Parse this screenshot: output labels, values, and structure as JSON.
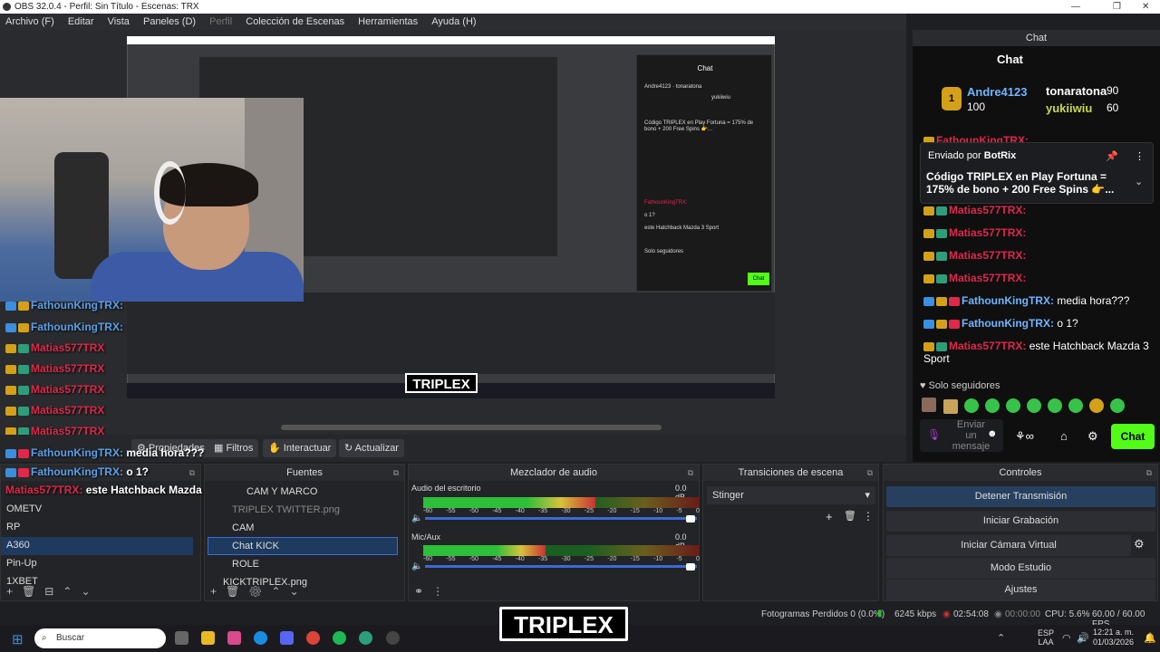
{
  "window": {
    "title": "OBS 32.0.4 - Perfil: Sin Título - Escenas: TRX"
  },
  "menu": [
    "Archivo (F)",
    "Editar",
    "Vista",
    "Paneles (D)",
    "Perfil",
    "Colección de Escenas",
    "Herramientas",
    "Ayuda (H)"
  ],
  "toolbar": {
    "properties": "Propiedades",
    "filters": "Filtros",
    "interact": "Interactuar",
    "refresh": "Actualizar"
  },
  "scenes": {
    "items": [
      "OMETV",
      "RP",
      "A360",
      "Pin-Up",
      "1XBET"
    ],
    "selected": "A360"
  },
  "sources": {
    "title": "Fuentes",
    "items": [
      {
        "label": "CAM Y MARCO"
      },
      {
        "label": "TRIPLEX TWITTER.png"
      },
      {
        "label": "CAM"
      },
      {
        "label": "Chat KICK"
      },
      {
        "label": "ROLE"
      },
      {
        "label": "KICKTRIPLEX.png"
      }
    ]
  },
  "mixer": {
    "title": "Mezclador de audio",
    "channels": [
      {
        "name": "Audio del escritorio",
        "db": "0.0 dB",
        "level": 0.62,
        "volume": 1.0
      },
      {
        "name": "Mic/Aux",
        "db": "0.0 dB",
        "level": 0.45,
        "volume": 1.0
      }
    ],
    "scale": [
      "-60",
      "-55",
      "-50",
      "-45",
      "-40",
      "-35",
      "-30",
      "-25",
      "-20",
      "-15",
      "-10",
      "-5",
      "0"
    ]
  },
  "transitions": {
    "title": "Transiciones de escena",
    "current": "Stinger"
  },
  "controls": {
    "title": "Controles",
    "buttons": [
      "Detener Transmisión",
      "Iniciar Grabación",
      "Iniciar Cámara Virtual",
      "Modo Estudio",
      "Ajustes"
    ]
  },
  "chat": {
    "title": "Chat",
    "header": "Chat",
    "top": [
      {
        "rank": "1",
        "name": "Andre4123",
        "points": "100"
      },
      {
        "name": "tonaratona",
        "points": "90"
      },
      {
        "name": "yukiiwiu",
        "points": "60"
      }
    ],
    "pinned": {
      "by_label": "Enviado por",
      "bot": "BotRix",
      "text": "Código TRIPLEX en Play Fortuna = 175% de bono + 200 Free Spins 👉..."
    },
    "messages": [
      {
        "user": "FathounKingTRX:",
        "text": ""
      },
      {
        "user": "Matias577TRX:",
        "text": ""
      },
      {
        "user": "Matias577TRX:",
        "text": ""
      },
      {
        "user": "Matias577TRX:",
        "text": ""
      },
      {
        "user": "Matias577TRX:",
        "text": ""
      },
      {
        "user": "FathounKingTRX:",
        "text": "media hora???"
      },
      {
        "user": "FathounKingTRX:",
        "text": "o 1?"
      },
      {
        "user": "Matias577TRX:",
        "text": "este Hatchback Mazda 3 Sport"
      }
    ],
    "followers_only": "Solo seguidores",
    "input_placeholder": "Enviar un mensaje",
    "send": "Chat"
  },
  "overlay_chat": [
    {
      "user": "FathounKingTRX:",
      "text": ""
    },
    {
      "user": "FathounKingTRX:",
      "text": ""
    },
    {
      "user": "Matias577TRX",
      "text": ""
    },
    {
      "user": "Matias577TRX",
      "text": ""
    },
    {
      "user": "Matias577TRX",
      "text": ""
    },
    {
      "user": "Matias577TRX",
      "text": ""
    },
    {
      "user": "Matias577TRX",
      "text": ""
    },
    {
      "user": "FathounKingTRX:",
      "text": "media hora???"
    },
    {
      "user": "FathounKingTRX:",
      "text": "o 1?"
    },
    {
      "user": "Matias577TRX:",
      "text": "este Hatchback Mazda 3 Sport"
    }
  ],
  "status": {
    "dropped": "Fotogramas Perdidos 0 (0.0%)",
    "kbps": "6245 kbps",
    "live": "02:54:08",
    "rec": "00:00:00",
    "cpu": "CPU: 5.6%",
    "fps": "60.00 / 60.00 FPS"
  },
  "taskbar": {
    "search": "Buscar",
    "lang1": "ESP",
    "lang2": "LAA",
    "time": "12:21 a. m.",
    "date": "01/03/2026"
  },
  "brand": {
    "logo": "TRIPLEX",
    "accent": "#53fc18"
  }
}
